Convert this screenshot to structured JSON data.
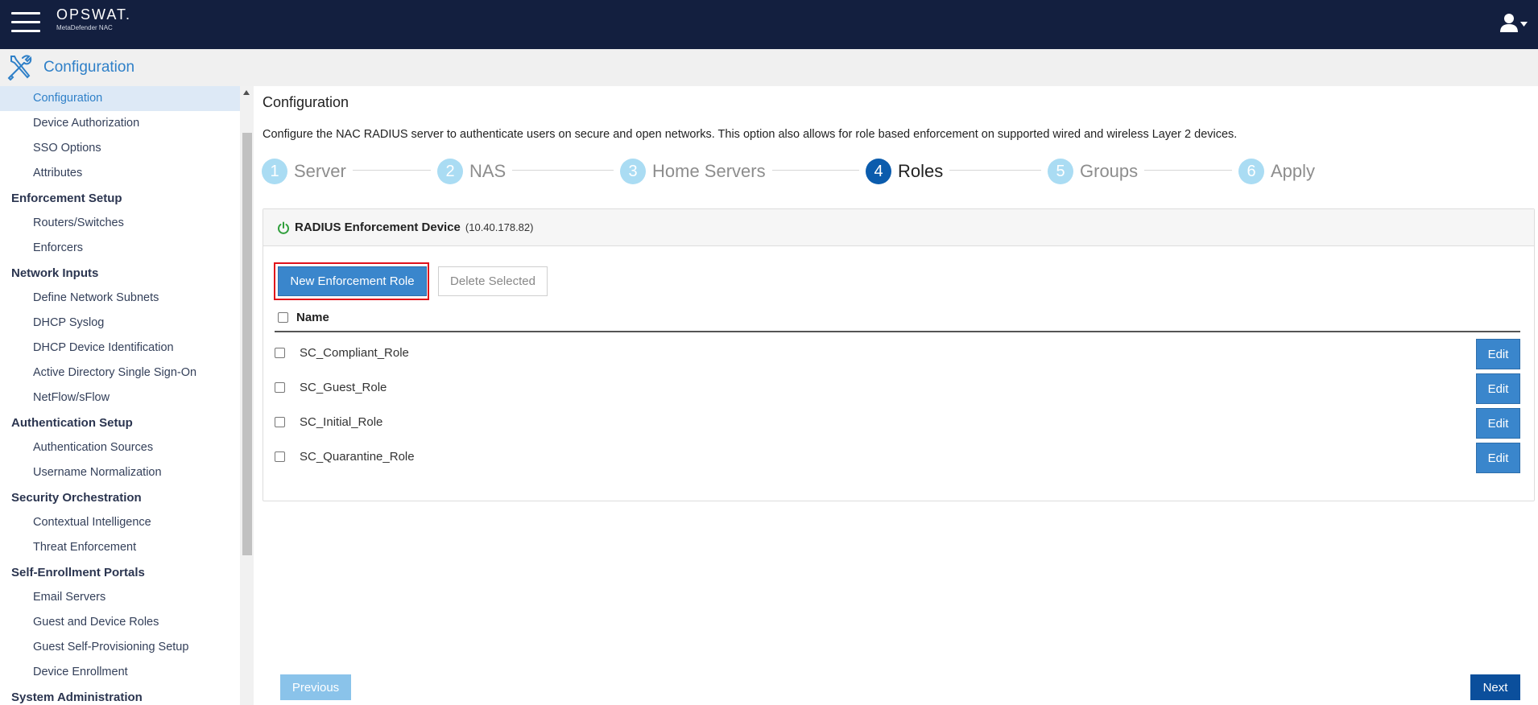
{
  "header": {
    "brand": "OPSWAT.",
    "product": "MetaDefender NAC",
    "menu_icon": "hamburger-icon",
    "user_icon": "user-icon"
  },
  "titlebar": {
    "icon": "tools-icon",
    "title": "Configuration"
  },
  "sidebar": {
    "groups": [
      {
        "section": "",
        "items": [
          "Configuration",
          "Device Authorization",
          "SSO Options",
          "Attributes"
        ]
      },
      {
        "section": "Enforcement Setup",
        "items": [
          "Routers/Switches",
          "Enforcers"
        ]
      },
      {
        "section": "Network Inputs",
        "items": [
          "Define Network Subnets",
          "DHCP Syslog",
          "DHCP Device Identification",
          "Active Directory Single Sign-On",
          "NetFlow/sFlow"
        ]
      },
      {
        "section": "Authentication Setup",
        "items": [
          "Authentication Sources",
          "Username Normalization"
        ]
      },
      {
        "section": "Security Orchestration",
        "items": [
          "Contextual Intelligence",
          "Threat Enforcement"
        ]
      },
      {
        "section": "Self-Enrollment Portals",
        "items": [
          "Email Servers",
          "Guest and Device Roles",
          "Guest Self-Provisioning Setup",
          "Device Enrollment"
        ]
      },
      {
        "section": "System Administration",
        "items": []
      }
    ],
    "active_item": "Configuration"
  },
  "main": {
    "title": "Configuration",
    "description": "Configure the NAC RADIUS server to authenticate users on secure and open networks. This option also allows for role based enforcement on supported wired and wireless Layer 2 devices.",
    "steps": [
      {
        "num": "1",
        "label": "Server"
      },
      {
        "num": "2",
        "label": "NAS"
      },
      {
        "num": "3",
        "label": "Home Servers"
      },
      {
        "num": "4",
        "label": "Roles"
      },
      {
        "num": "5",
        "label": "Groups"
      },
      {
        "num": "6",
        "label": "Apply"
      }
    ],
    "current_step": "4",
    "panel": {
      "status_icon": "power-icon",
      "device_name": "RADIUS Enforcement Device",
      "device_ip": "(10.40.178.82)",
      "new_button": "New Enforcement Role",
      "delete_button": "Delete Selected",
      "column_name": "Name",
      "rows": [
        "SC_Compliant_Role",
        "SC_Guest_Role",
        "SC_Initial_Role",
        "SC_Quarantine_Role"
      ],
      "edit_label": "Edit"
    },
    "prev_button": "Previous",
    "next_button": "Next"
  },
  "colors": {
    "topbar": "#131f3f",
    "accent": "#2f80c8",
    "step_current": "#0b5cad",
    "step_inactive": "#aadcf3",
    "highlight": "#e0101a",
    "next_button": "#0b4f9c"
  }
}
